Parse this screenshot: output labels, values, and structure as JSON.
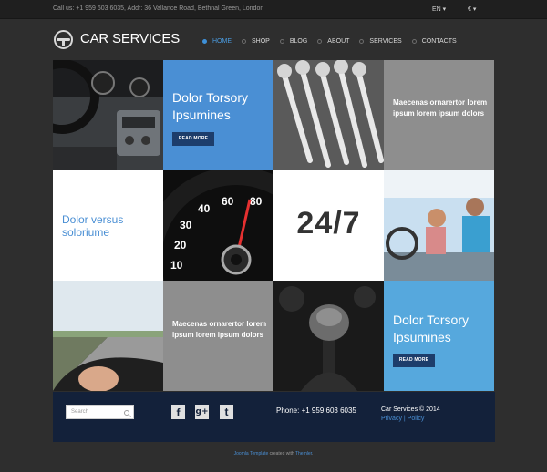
{
  "topbar": {
    "info": "Call us: +1 959 603 6035, Addr: 36 Vallance Road, Bethnal Green, London",
    "language": "EN ▾",
    "currency": "€ ▾"
  },
  "header": {
    "logo_icon": "steering-wheel-icon",
    "logo_text": "CAR SERVICES"
  },
  "nav": {
    "items": [
      {
        "label": "HOME",
        "active": true
      },
      {
        "label": "SHOP"
      },
      {
        "label": "BLOG"
      },
      {
        "label": "ABOUT"
      },
      {
        "label": "SERVICES"
      },
      {
        "label": "CONTACTS"
      }
    ]
  },
  "tiles": {
    "t1_title_line1": "Dolor Torsory",
    "t1_title_line2": "Ipsumines",
    "t1_button": "READ MORE",
    "t2_text": "Maecenas ornarertor lorem ipsum lorem ipsum dolors",
    "t3_title_line1": "Dolor versus",
    "t3_title_line2": "soloriume",
    "t4_big": "24/7",
    "t5_text": "Maecenas ornarertor lorem ipsum lorem ipsum dolors",
    "t6_title_line1": "Dolor Torsory",
    "t6_title_line2": "Ipsumines",
    "t6_button": "READ MORE",
    "speedo_labels": [
      "10",
      "20",
      "30",
      "40",
      "60",
      "80"
    ]
  },
  "footer": {
    "search_placeholder": "Search",
    "social": {
      "facebook": "f",
      "googleplus": "g+",
      "tumblr": "t"
    },
    "phone": "Phone: +1 959 603 6035",
    "copyright": "Car Services © 2014",
    "privacy": "Privacy",
    "separator": "|",
    "policy": "Policy"
  },
  "credit": {
    "link1": "Joomla Template",
    "middle": " created with ",
    "link2": "Themler",
    "end": "."
  },
  "colors": {
    "accent_blue": "#4a8fd4",
    "light_blue": "#56a8dd",
    "footer_navy": "#13213a",
    "button_navy": "#1d3d6b"
  }
}
